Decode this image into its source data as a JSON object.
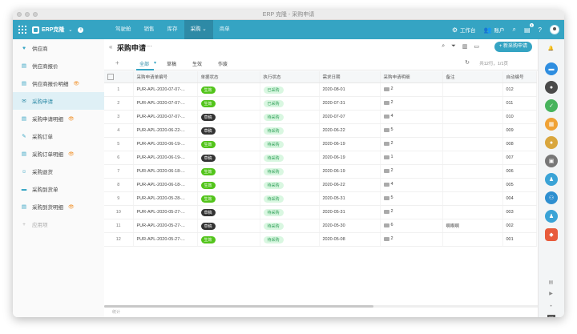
{
  "window": {
    "title": "ERP 克隆 - 采购申请"
  },
  "topnav": {
    "brand": "ERP克隆",
    "tabs": [
      "驾驶舱",
      "销售",
      "库存",
      "采购",
      "商单"
    ],
    "active_tab": "采购",
    "workbench": "工作台",
    "account": "账户",
    "notif_count": "1"
  },
  "sidebar": {
    "items": [
      {
        "label": "供应商",
        "icon": "heart-icon"
      },
      {
        "label": "供应商报价",
        "icon": "doc-icon"
      },
      {
        "label": "供应商报价明细",
        "icon": "doc-icon",
        "eye": true
      },
      {
        "label": "采购申请",
        "icon": "mail-icon",
        "active": true
      },
      {
        "label": "采购申请明细",
        "icon": "doc-icon",
        "eye": true
      },
      {
        "label": "采购订单",
        "icon": "edit-icon"
      },
      {
        "label": "采购订单明细",
        "icon": "doc-icon",
        "eye": true
      },
      {
        "label": "采购退货",
        "icon": "return-icon"
      },
      {
        "label": "采购到货单",
        "icon": "truck-icon"
      },
      {
        "label": "采购到货明细",
        "icon": "doc-icon",
        "eye": true
      }
    ],
    "add_label": "应用项"
  },
  "page": {
    "title": "采购申请",
    "more": "···",
    "new_button": "+ 新采购申请",
    "subtabs": [
      "全部",
      "草稿",
      "生效",
      "作废"
    ],
    "pager": "共12行，1/1页",
    "footer": "统计"
  },
  "table": {
    "headers": [
      "",
      "采购申请单编号",
      "单据状态",
      "执行状态",
      "需求日期",
      "采购申请明细",
      "备注",
      "自动编号"
    ],
    "rows": [
      {
        "n": "1",
        "code": "PUR-APL-2020-07-07-...",
        "status": "生效",
        "status_type": "green",
        "exec": "已采购",
        "date": "2020-08-01",
        "qty": "2",
        "note": "",
        "auto": "012"
      },
      {
        "n": "2",
        "code": "PUR-APL-2020-07-07-...",
        "status": "生效",
        "status_type": "green",
        "exec": "已采购",
        "date": "2020-07-31",
        "qty": "2",
        "note": "",
        "auto": "011"
      },
      {
        "n": "3",
        "code": "PUR-APL-2020-07-07-...",
        "status": "草稿",
        "status_type": "dark",
        "exec": "待采购",
        "date": "2020-07-07",
        "qty": "4",
        "note": "",
        "auto": "010"
      },
      {
        "n": "4",
        "code": "PUR-APL-2020-06-22-...",
        "status": "草稿",
        "status_type": "dark",
        "exec": "待采购",
        "date": "2020-06-22",
        "qty": "5",
        "note": "",
        "auto": "009"
      },
      {
        "n": "5",
        "code": "PUR-APL-2020-06-19-...",
        "status": "生效",
        "status_type": "green",
        "exec": "待采购",
        "date": "2020-06-19",
        "qty": "2",
        "note": "",
        "auto": "008"
      },
      {
        "n": "6",
        "code": "PUR-APL-2020-06-19-...",
        "status": "草稿",
        "status_type": "dark",
        "exec": "待采购",
        "date": "2020-06-19",
        "qty": "1",
        "note": "",
        "auto": "007"
      },
      {
        "n": "7",
        "code": "PUR-APL-2020-06-18-...",
        "status": "生效",
        "status_type": "green",
        "exec": "待采购",
        "date": "2020-06-19",
        "qty": "2",
        "note": "",
        "auto": "006"
      },
      {
        "n": "8",
        "code": "PUR-APL-2020-06-18-...",
        "status": "生效",
        "status_type": "green",
        "exec": "待采购",
        "date": "2020-06-22",
        "qty": "4",
        "note": "",
        "auto": "005"
      },
      {
        "n": "9",
        "code": "PUR-APL-2020-05-28-...",
        "status": "生效",
        "status_type": "green",
        "exec": "待采购",
        "date": "2020-05-31",
        "qty": "5",
        "note": "",
        "auto": "004"
      },
      {
        "n": "10",
        "code": "PUR-APL-2020-05-27-...",
        "status": "草稿",
        "status_type": "dark",
        "exec": "待采购",
        "date": "2020-05-31",
        "qty": "2",
        "note": "",
        "auto": "003"
      },
      {
        "n": "11",
        "code": "PUR-APL-2020-05-27-...",
        "status": "草稿",
        "status_type": "dark",
        "exec": "待采购",
        "date": "2020-05-30",
        "qty": "6",
        "note": "啊啊啊",
        "auto": "002"
      },
      {
        "n": "12",
        "code": "PUR-APL-2020-05-27-...",
        "status": "生效",
        "status_type": "green",
        "exec": "待采购",
        "date": "2020-05-08",
        "qty": "2",
        "note": "",
        "auto": "001"
      }
    ]
  },
  "colors": {
    "accent": "#35a4c3",
    "green": "#52c41a",
    "dark": "#333333"
  }
}
